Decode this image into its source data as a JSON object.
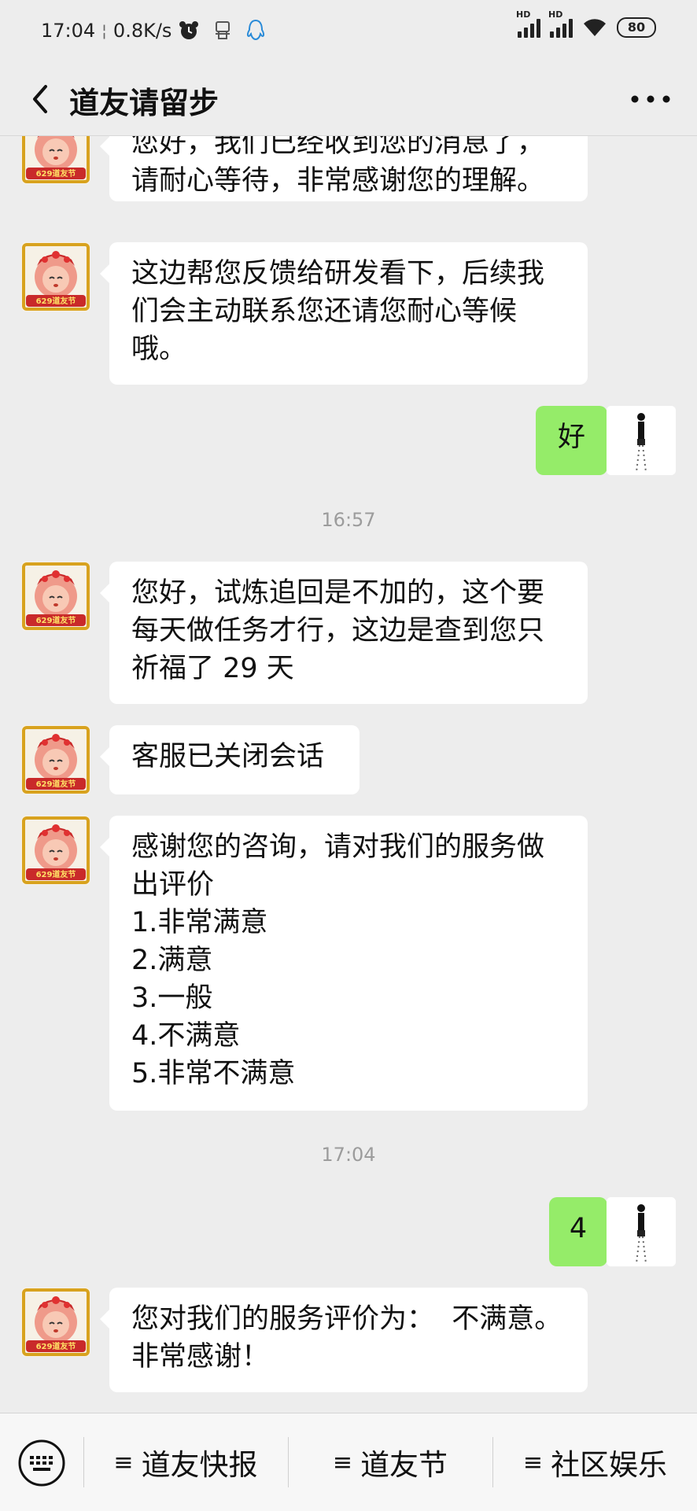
{
  "status_bar": {
    "time": "17:04",
    "speed": "0.8K/s",
    "sim1": "HD",
    "sim2": "HD",
    "battery": "80",
    "icons": [
      "alarm-icon",
      "robot-icon",
      "qq-penguin-icon",
      "signal-icon",
      "wifi-icon",
      "battery-icon"
    ]
  },
  "header": {
    "title": "道友请留步",
    "back_icon": "chevron-left-icon",
    "more_icon": "more-dots-icon"
  },
  "messages": [
    {
      "from": "service",
      "text": "您好，我们已经收到您的消息了，请耐心等待，非常感谢您的理解。"
    },
    {
      "from": "service",
      "text": "这边帮您反馈给研发看下，后续我们会主动联系您还请您耐心等候哦。"
    },
    {
      "from": "me",
      "text": "好"
    },
    {
      "type": "time",
      "text": "16:57"
    },
    {
      "from": "service",
      "text": "您好，试炼追回是不加的，这个要每天做任务才行，这边是查到您只祈福了 29 天"
    },
    {
      "from": "service",
      "text": "客服已关闭会话"
    },
    {
      "from": "service",
      "text": "感谢您的咨询，请对我们的服务做出评价\n1.非常满意\n2.满意\n3.一般\n4.不满意\n5.非常不满意"
    },
    {
      "type": "time",
      "text": "17:04"
    },
    {
      "from": "me",
      "text": "4"
    },
    {
      "from": "service",
      "text": "您对我们的服务评价为：  不满意。非常感谢！"
    }
  ],
  "avatar_badge": "629道友节",
  "bottom_bar": {
    "keyboard_icon": "keyboard-icon",
    "menu": [
      "道友快报",
      "道友节",
      "社区娱乐"
    ],
    "menu_icon": "hamburger-icon"
  },
  "colors": {
    "background": "#ededed",
    "incoming_bubble": "#ffffff",
    "outgoing_bubble": "#95ec69"
  }
}
